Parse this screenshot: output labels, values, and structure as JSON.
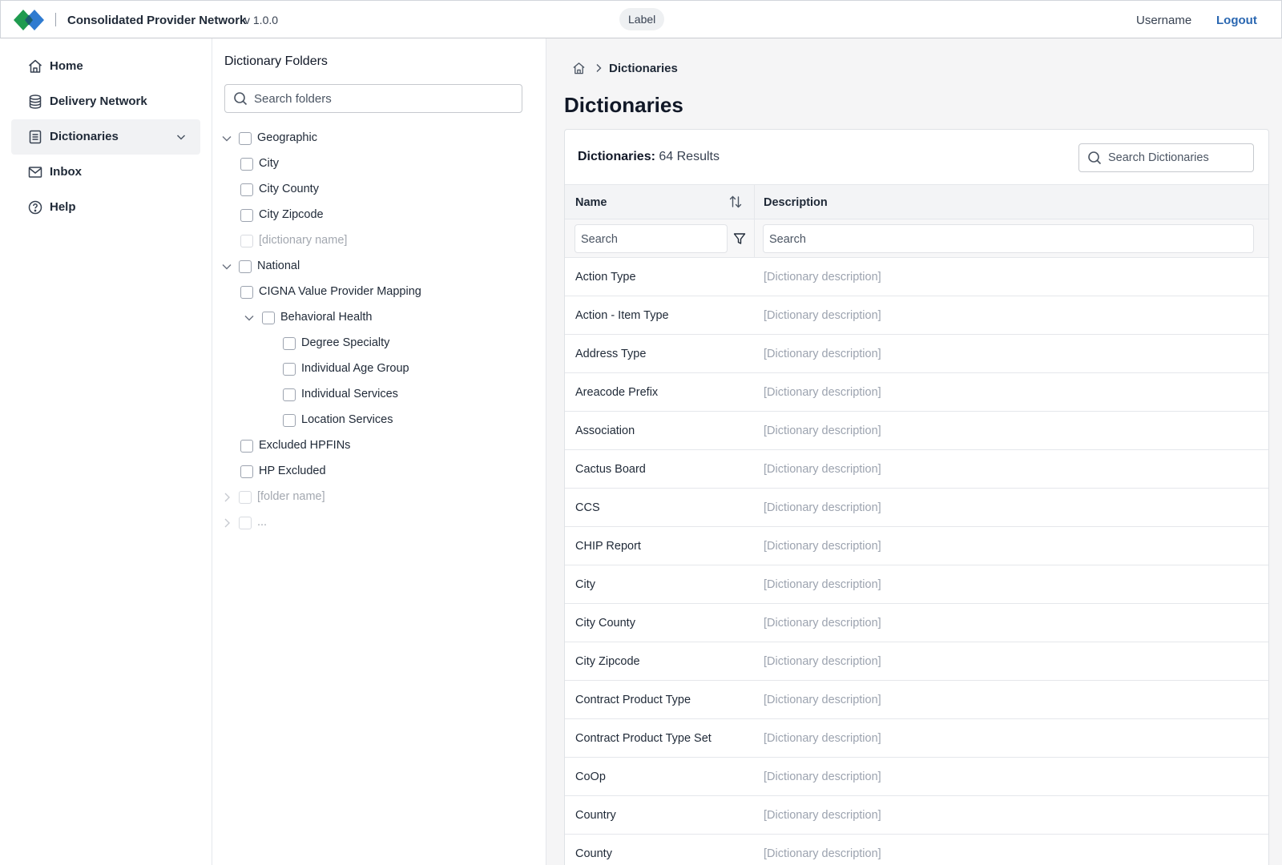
{
  "header": {
    "app_title": "Consolidated Provider Network",
    "version": "v 1.0.0",
    "label": "Label",
    "username": "Username",
    "logout": "Logout",
    "logo_colors": [
      "#1f9b4f",
      "#2f7bd0"
    ]
  },
  "nav": {
    "items": [
      {
        "label": "Home",
        "icon": "home-icon"
      },
      {
        "label": "Delivery Network",
        "icon": "database-icon"
      },
      {
        "label": "Dictionaries",
        "icon": "document-list-icon",
        "active": true,
        "expandable": true
      },
      {
        "label": "Inbox",
        "icon": "mail-icon"
      },
      {
        "label": "Help",
        "icon": "help-circle-icon"
      }
    ]
  },
  "folders": {
    "title": "Dictionary Folders",
    "search_placeholder": "Search folders",
    "tree": [
      {
        "label": "Geographic",
        "chevron": "down"
      },
      {
        "label": "City"
      },
      {
        "label": "City County"
      },
      {
        "label": "City Zipcode"
      },
      {
        "label": "[dictionary name]",
        "faded": true
      },
      {
        "label": "National",
        "chevron": "down"
      },
      {
        "label": "CIGNA Value Provider Mapping"
      },
      {
        "label": "Behavioral Health",
        "chevron": "down"
      },
      {
        "label": "Degree Specialty"
      },
      {
        "label": "Individual Age Group"
      },
      {
        "label": "Individual Services"
      },
      {
        "label": "Location Services"
      },
      {
        "label": "Excluded HPFINs"
      },
      {
        "label": "HP Excluded"
      },
      {
        "label": "[folder name]",
        "chevron": "right",
        "faded": true
      },
      {
        "label": "...",
        "chevron": "right",
        "faded": true
      }
    ]
  },
  "main": {
    "breadcrumb_current": "Dictionaries",
    "page_title": "Dictionaries",
    "results_label": "Dictionaries:",
    "results_value": "64 Results",
    "search_placeholder": "Search Dictionaries",
    "columns": {
      "name": "Name",
      "description": "Description"
    },
    "filter_placeholder": "Search",
    "rows": [
      {
        "name": "Action Type",
        "description": "[Dictionary description]"
      },
      {
        "name": "Action - Item Type",
        "description": "[Dictionary description]"
      },
      {
        "name": "Address Type",
        "description": "[Dictionary description]"
      },
      {
        "name": "Areacode Prefix",
        "description": "[Dictionary description]"
      },
      {
        "name": "Association",
        "description": "[Dictionary description]"
      },
      {
        "name": "Cactus Board",
        "description": "[Dictionary description]"
      },
      {
        "name": "CCS",
        "description": "[Dictionary description]"
      },
      {
        "name": "CHIP Report",
        "description": "[Dictionary description]"
      },
      {
        "name": "City",
        "description": "[Dictionary description]"
      },
      {
        "name": "City County",
        "description": "[Dictionary description]"
      },
      {
        "name": "City Zipcode",
        "description": "[Dictionary description]"
      },
      {
        "name": "Contract Product Type",
        "description": "[Dictionary description]"
      },
      {
        "name": "Contract Product Type Set",
        "description": "[Dictionary description]"
      },
      {
        "name": "CoOp",
        "description": "[Dictionary description]"
      },
      {
        "name": "Country",
        "description": "[Dictionary description]"
      },
      {
        "name": "County",
        "description": "[Dictionary description]"
      }
    ]
  }
}
